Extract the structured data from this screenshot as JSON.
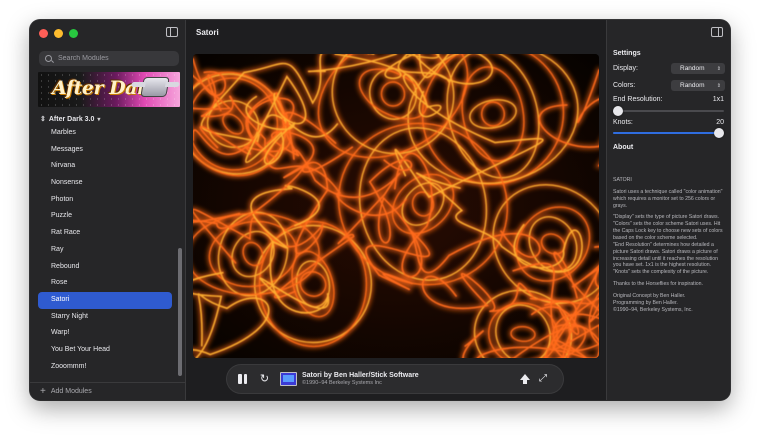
{
  "sidebar": {
    "search_placeholder": "Search Modules",
    "logo_text": "After Dark",
    "version_label": "After Dark 3.0",
    "modules": [
      "Marbles",
      "Messages",
      "Nirvana",
      "Nonsense",
      "Photon",
      "Puzzle",
      "Rat Race",
      "Ray",
      "Rebound",
      "Rose",
      "Satori",
      "Starry Night",
      "Warp!",
      "You Bet Your Head",
      "Zooommm!"
    ],
    "selected_module": "Satori",
    "add_label": "Add Modules"
  },
  "main": {
    "title": "Satori",
    "now_playing_title": "Satori by Ben Haller/Stick Software",
    "now_playing_copyright": "©1990–94 Berkeley Systems Inc"
  },
  "settings": {
    "heading": "Settings",
    "display_label": "Display:",
    "display_value": "Random",
    "colors_label": "Colors:",
    "colors_value": "Random",
    "end_resolution_label": "End Resolution:",
    "end_resolution_value": "1x1",
    "end_resolution_fraction": 0.0,
    "knots_label": "Knots:",
    "knots_value": "20",
    "knots_fraction": 1.0,
    "about_heading": "About",
    "about_paragraphs": [
      "SATORI",
      "Satori uses a technique called \"color animation\" which requires a monitor set to 256 colors or grays.",
      "\"Display\" sets the type of picture Satori draws.\n\"Colors\" sets the color scheme Satori uses. Hit the Caps Lock key to choose new sets of colors based on the color scheme selected.\n\"End Resolution\" determines how detailed a picture Satori draws.  Satori draws a picture of increasing detail until it reaches the resolution you have set. 1x1 is the highest resolution.\n\"Knots\" sets the complexity of the picture.",
      "Thanks to the Horseflies for inspiration.",
      "Original Concept by Ben Haller.\nProgramming by Ben Haller.\n©1990–94, Berkeley Systems, Inc."
    ]
  },
  "colors": {
    "accent": "#2f5bd0",
    "preview_primary": "#ff6a1a",
    "preview_secondary": "#ffb030",
    "preview_background": "#0a0502"
  }
}
